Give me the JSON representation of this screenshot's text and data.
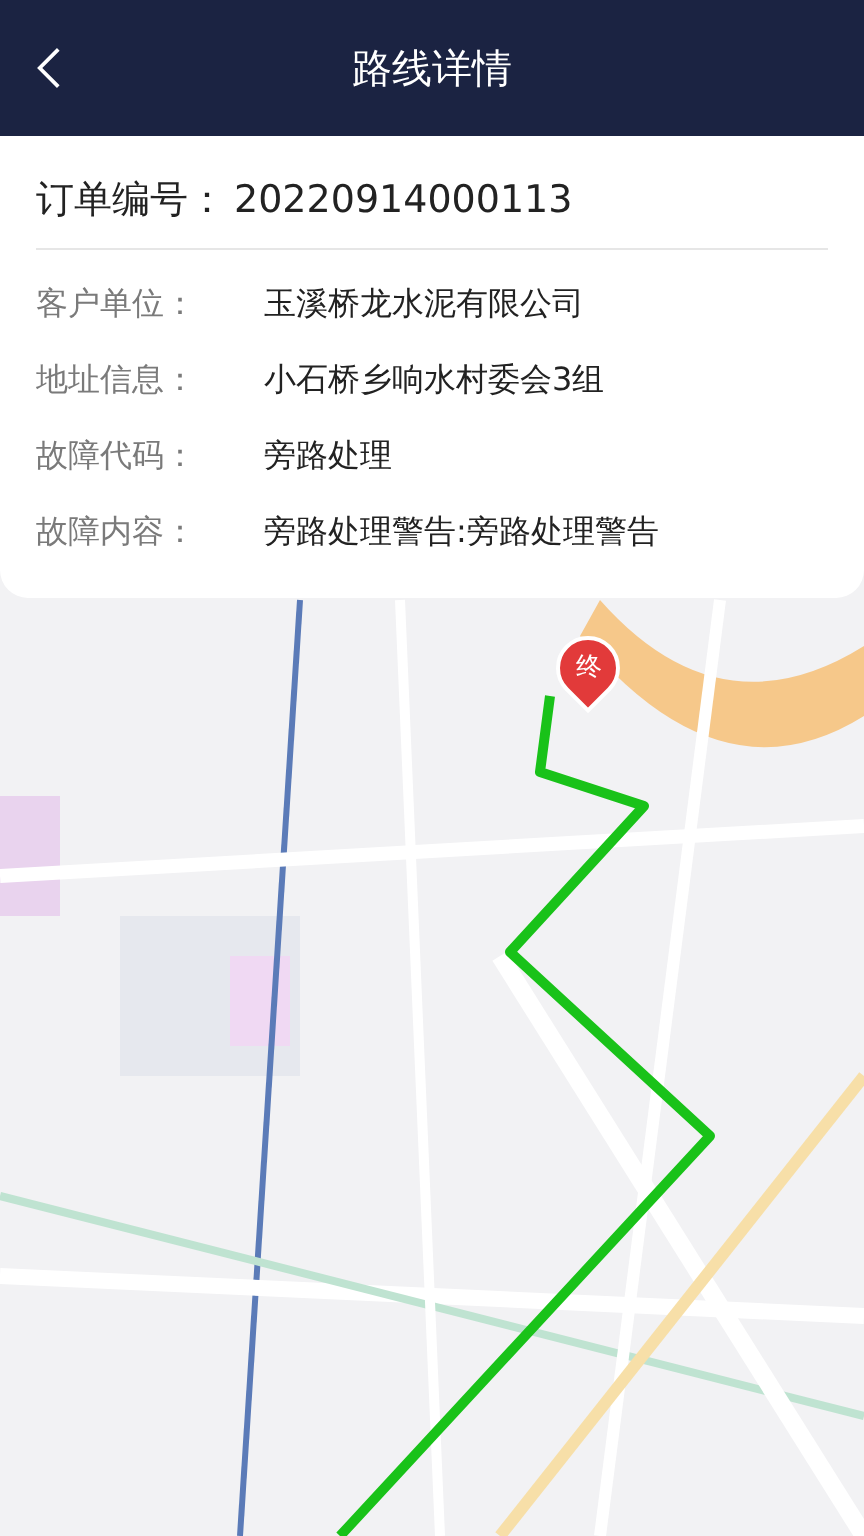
{
  "header": {
    "title": "路线详情"
  },
  "order": {
    "label": "订单编号：",
    "value": "20220914000113"
  },
  "fields": [
    {
      "label": "客户单位：",
      "value": "玉溪桥龙水泥有限公司"
    },
    {
      "label": "地址信息：",
      "value": "小石桥乡响水村委会3组"
    },
    {
      "label": "故障代码：",
      "value": "旁路处理"
    },
    {
      "label": "故障内容：",
      "value": "旁路处理警告:旁路处理警告"
    }
  ],
  "map": {
    "kind": "picture",
    "end_marker": "终"
  }
}
